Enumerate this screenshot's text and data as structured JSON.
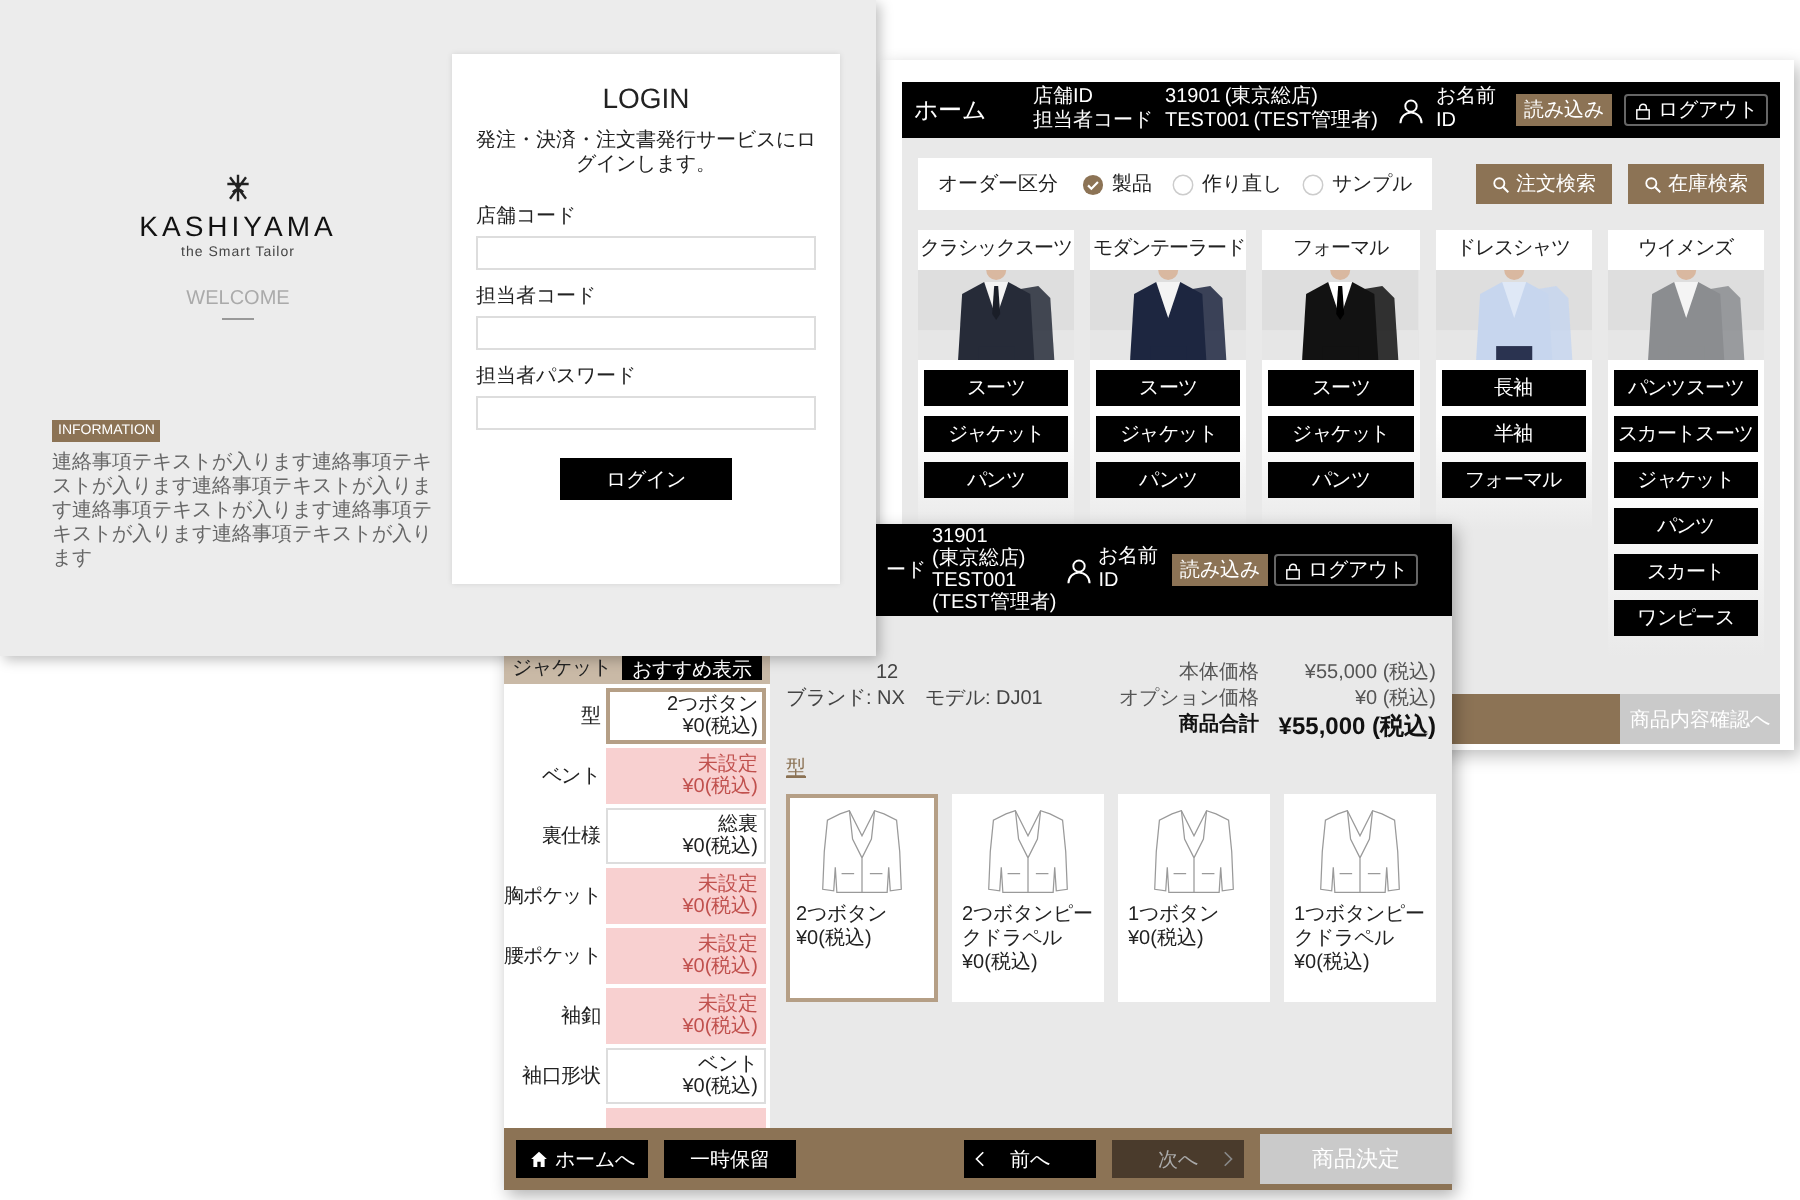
{
  "login_screen": {
    "brand": {
      "name": "KASHIYAMA",
      "tagline": "the Smart Tailor",
      "welcome": "WELCOME"
    },
    "information": {
      "badge": "INFORMATION",
      "text": "連絡事項テキストが入ります連絡事項テキストが入ります連絡事項テキストが入ります連絡事項テキストが入ります連絡事項テキストが入ります連絡事項テキストが入ります"
    },
    "form": {
      "title": "LOGIN",
      "subtitle": "発注・決済・注文書発行サービスにログインします。",
      "fields": [
        {
          "label": "店舗コード"
        },
        {
          "label": "担当者コード"
        },
        {
          "label": "担当者パスワード"
        }
      ],
      "submit": "ログイン"
    }
  },
  "home_screen": {
    "header": {
      "title": "ホーム",
      "store_label": "店舗ID",
      "store_id": "31901",
      "store_name": "(東京総店)",
      "staff_label": "担当者コード",
      "staff_code": "TEST001",
      "staff_name": "(TEST管理者)",
      "name_label": "お名前",
      "user_id": "ID",
      "load_button": "読み込み",
      "logout_button": "ログアウト"
    },
    "order_type": {
      "label": "オーダー区分",
      "options": [
        {
          "label": "製品",
          "selected": true
        },
        {
          "label": "作り直し",
          "selected": false
        },
        {
          "label": "サンプル",
          "selected": false
        }
      ]
    },
    "search_buttons": [
      "注文検索",
      "在庫検索"
    ],
    "categories": [
      {
        "title": "クラシックスーツ",
        "image": {
          "kind": "picture"
        },
        "buttons": [
          "スーツ",
          "ジャケット",
          "パンツ"
        ]
      },
      {
        "title": "モダンテーラード",
        "image": {
          "kind": "picture"
        },
        "buttons": [
          "スーツ",
          "ジャケット",
          "パンツ"
        ]
      },
      {
        "title": "フォーマル",
        "image": {
          "kind": "picture"
        },
        "buttons": [
          "スーツ",
          "ジャケット",
          "パンツ"
        ]
      },
      {
        "title": "ドレスシャツ",
        "image": {
          "kind": "picture"
        },
        "buttons": [
          "長袖",
          "半袖",
          "フォーマル"
        ]
      },
      {
        "title": "ウイメンズ",
        "image": {
          "kind": "picture"
        },
        "buttons": [
          "パンツスーツ",
          "スカートスーツ",
          "ジャケット",
          "パンツ",
          "スカート",
          "ワンピース"
        ]
      }
    ],
    "footer": {
      "next_button": "商品内容確認へ"
    }
  },
  "product_screen": {
    "header": {
      "staff_label_fragment": "ード",
      "store_id": "31901",
      "store_name": "(東京総店)",
      "staff_code": "TEST001",
      "staff_name": "(TEST管理者)",
      "name_label": "お名前",
      "user_id": "ID",
      "load_button": "読み込み",
      "logout_button": "ログアウト"
    },
    "options_panel": {
      "title": "ジャケット",
      "recommend_button": "おすすめ表示",
      "rows": [
        {
          "label": "型",
          "value": "2つボタン",
          "price": "¥0(税込)",
          "set": true,
          "selected": true
        },
        {
          "label": "ベント",
          "value": "未設定",
          "price": "¥0(税込)",
          "set": false,
          "selected": false
        },
        {
          "label": "裏仕様",
          "value": "総裏",
          "price": "¥0(税込)",
          "set": true,
          "selected": false
        },
        {
          "label": "胸ポケット",
          "value": "未設定",
          "price": "¥0(税込)",
          "set": false,
          "selected": false
        },
        {
          "label": "腰ポケット",
          "value": "未設定",
          "price": "¥0(税込)",
          "set": false,
          "selected": false
        },
        {
          "label": "袖釦",
          "value": "未設定",
          "price": "¥0(税込)",
          "set": false,
          "selected": false
        },
        {
          "label": "袖口形状",
          "value": "ベント",
          "price": "¥0(税込)",
          "set": true,
          "selected": false
        },
        {
          "set": false,
          "selected": false
        }
      ]
    },
    "product_info": {
      "code_fragment": "12",
      "brand_model": "ブランド: NX　モデル: DJ01"
    },
    "prices": [
      {
        "label": "本体価格",
        "value": "¥55,000 (税込)",
        "kind": "normal"
      },
      {
        "label": "オプション価格",
        "value": "¥0 (税込)",
        "kind": "normal"
      },
      {
        "label": "商品合計",
        "value": "¥55,000 (税込)",
        "kind": "total"
      }
    ],
    "section_title": "型",
    "choices": [
      {
        "name": "2つボタン",
        "price": "¥0(税込)",
        "selected": true
      },
      {
        "name": "2つボタンピークドラペル",
        "price": "¥0(税込)",
        "selected": false
      },
      {
        "name": "1つボタン",
        "price": "¥0(税込)",
        "selected": false
      },
      {
        "name": "1つボタンピークドラペル",
        "price": "¥0(税込)",
        "selected": false
      }
    ],
    "footer": {
      "buttons": [
        {
          "label": "ホームへ",
          "kind": "home",
          "disabled": false
        },
        {
          "label": "一時保留",
          "kind": "plain",
          "disabled": false
        },
        {
          "label": "前へ",
          "kind": "prev",
          "disabled": false
        },
        {
          "label": "次へ",
          "kind": "next",
          "disabled": true
        }
      ],
      "confirm": {
        "label": "商品決定",
        "disabled": true
      }
    }
  }
}
